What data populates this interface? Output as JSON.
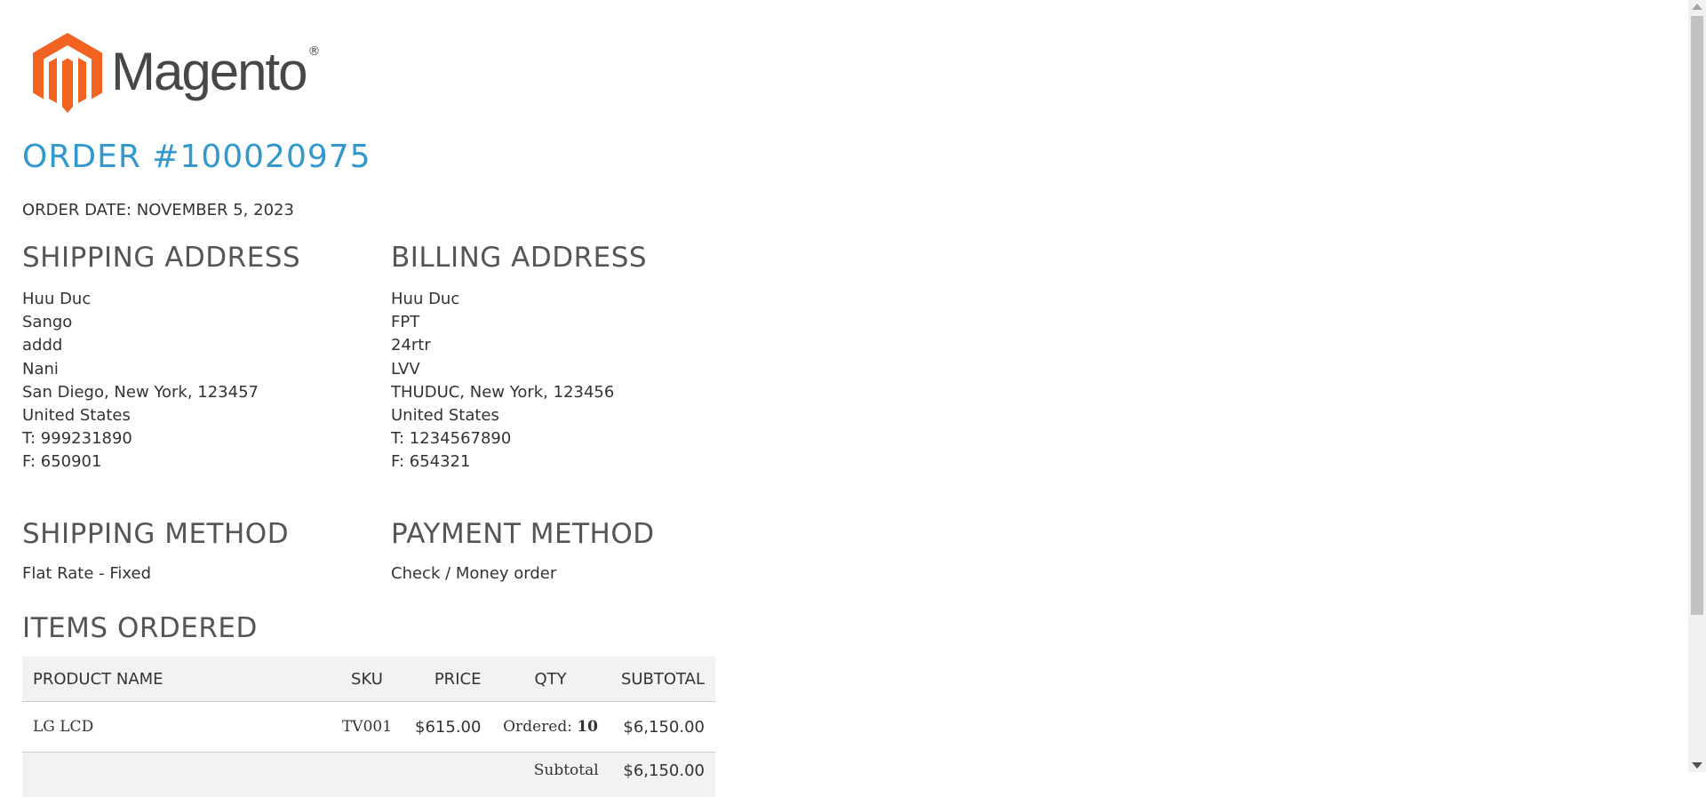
{
  "logo": {
    "wordmark": "Magento",
    "registered": "®",
    "brand_color": "#f26322"
  },
  "order": {
    "title": "ORDER #100020975",
    "date": "ORDER DATE: NOVEMBER 5, 2023"
  },
  "shipping_address": {
    "title": "SHIPPING ADDRESS",
    "lines": [
      "Huu Duc",
      "Sango",
      "addd",
      "Nani",
      "San Diego, New York, 123457",
      "United States",
      "T: 999231890",
      "F: 650901"
    ]
  },
  "billing_address": {
    "title": "BILLING ADDRESS",
    "lines": [
      "Huu Duc",
      "FPT",
      "24rtr",
      "LVV",
      "THUDUC, New York, 123456",
      "United States",
      "T: 1234567890",
      "F: 654321"
    ]
  },
  "shipping_method": {
    "title": "SHIPPING METHOD",
    "value": "Flat Rate - Fixed"
  },
  "payment_method": {
    "title": "PAYMENT METHOD",
    "value": "Check / Money order"
  },
  "items": {
    "title": "ITEMS ORDERED",
    "columns": {
      "product": "PRODUCT NAME",
      "sku": "SKU",
      "price": "PRICE",
      "qty": "QTY",
      "subtotal": "SUBTOTAL"
    },
    "rows": [
      {
        "product": "LG LCD",
        "sku": "TV001",
        "price": "$615.00",
        "qty_label": "Ordered:",
        "qty_value": "10",
        "subtotal": "$6,150.00"
      }
    ],
    "totals": {
      "subtotal_label": "Subtotal",
      "subtotal_value": "$6,150.00"
    }
  },
  "colors": {
    "title_blue": "#3399cc",
    "table_header_bg": "#f2f2f2"
  }
}
